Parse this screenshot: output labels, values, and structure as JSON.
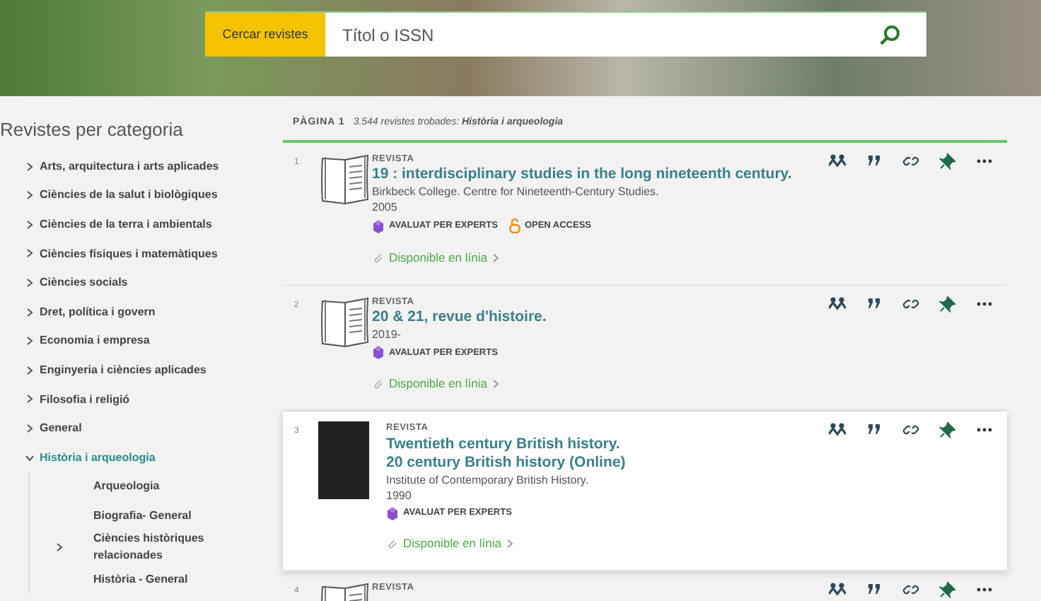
{
  "search": {
    "label": "Cercar revistes",
    "placeholder": "Títol o ISSN"
  },
  "sidebar": {
    "title": "Revistes per categoria",
    "items": [
      {
        "label": "Arts, arquitectura i arts aplicades",
        "expanded": false,
        "selected": false
      },
      {
        "label": "Ciències de la salut i biològiques",
        "expanded": false,
        "selected": false
      },
      {
        "label": "Ciències de la terra i ambientals",
        "expanded": false,
        "selected": false
      },
      {
        "label": "Ciències físiques i matemàtiques",
        "expanded": false,
        "selected": false
      },
      {
        "label": "Ciències socials",
        "expanded": false,
        "selected": false
      },
      {
        "label": "Dret, política i govern",
        "expanded": false,
        "selected": false
      },
      {
        "label": "Economia i empresa",
        "expanded": false,
        "selected": false
      },
      {
        "label": "Enginyeria i ciències aplicades",
        "expanded": false,
        "selected": false
      },
      {
        "label": "Filosofia i religió",
        "expanded": false,
        "selected": false
      },
      {
        "label": "General",
        "expanded": false,
        "selected": false
      },
      {
        "label": "Història i arqueologia",
        "expanded": true,
        "selected": true,
        "children": [
          {
            "label": "Arqueologia",
            "has_children": false
          },
          {
            "label": "Biografia- General",
            "has_children": false
          },
          {
            "label": "Ciències històriques relacionades",
            "has_children": true
          },
          {
            "label": "Història - General",
            "has_children": false
          }
        ]
      }
    ]
  },
  "results_header": {
    "page": "PÀGINA 1",
    "summary": "3.544 revistes trobades: **Història i arqueologia**"
  },
  "results": [
    {
      "number": "1",
      "kind": "book",
      "type": "REVISTA",
      "title": [
        "19 : interdisciplinary studies in the long nineteenth century."
      ],
      "publisher": "Birkbeck College. Centre for Nineteenth-Century Studies.",
      "year": "2005",
      "badges": [
        {
          "kind": "peer",
          "label": "AVALUAT PER EXPERTS"
        },
        {
          "kind": "open",
          "label": "OPEN ACCESS"
        }
      ],
      "availability": "Disponible en línia",
      "highlighted": false
    },
    {
      "number": "2",
      "kind": "book",
      "type": "REVISTA",
      "title": [
        "20 & 21, revue d'histoire."
      ],
      "year": "2019-",
      "badges": [
        {
          "kind": "peer",
          "label": "AVALUAT PER EXPERTS"
        }
      ],
      "availability": "Disponible en línia",
      "highlighted": false
    },
    {
      "number": "3",
      "kind": "cover",
      "type": "REVISTA",
      "title": [
        "Twentieth century British history.",
        "20 century British history (Online)"
      ],
      "publisher": "Institute of Contemporary British History.",
      "year": "1990",
      "badges": [
        {
          "kind": "peer",
          "label": "AVALUAT PER EXPERTS"
        }
      ],
      "availability": "Disponible en línia",
      "highlighted": true
    },
    {
      "number": "4",
      "kind": "book",
      "type": "REVISTA",
      "highlighted": false
    }
  ]
}
